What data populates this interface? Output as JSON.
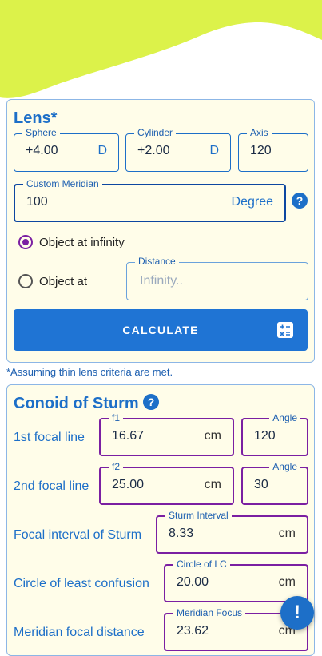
{
  "lens": {
    "title": "Lens*",
    "sphere": {
      "label": "Sphere",
      "value": "+4.00",
      "unit": "D"
    },
    "cylinder": {
      "label": "Cylinder",
      "value": "+2.00",
      "unit": "D"
    },
    "axis": {
      "label": "Axis",
      "value": "120"
    },
    "custom_meridian": {
      "label": "Custom Meridian",
      "value": "100",
      "unit": "Degree"
    },
    "help_glyph": "?",
    "option_infinity": "Object at infinity",
    "option_at": "Object at",
    "distance": {
      "label": "Distance",
      "placeholder": "Infinity.."
    },
    "calculate_label": "CALCULATE",
    "calc_icon": "calculator-icon"
  },
  "note": "*Assuming thin lens criteria are met.",
  "sturm": {
    "title": "Conoid of Sturm",
    "help_glyph": "?",
    "rows": [
      {
        "label": "1st focal line",
        "field_label": "f1",
        "value": "16.67",
        "unit": "cm",
        "angle_label": "Angle",
        "angle": "120"
      },
      {
        "label": "2nd focal line",
        "field_label": "f2",
        "value": "25.00",
        "unit": "cm",
        "angle_label": "Angle",
        "angle": "30"
      }
    ],
    "interval": {
      "label": "Focal interval of Sturm",
      "field_label": "Sturm Interval",
      "value": "8.33",
      "unit": "cm"
    },
    "circle": {
      "label": "Circle of least confusion",
      "field_label": "Circle of LC",
      "value": "20.00",
      "unit": "cm"
    },
    "meridian": {
      "label": "Meridian focal distance",
      "field_label": "Meridian Focus",
      "value": "23.62",
      "unit": "cm"
    }
  },
  "fab_glyph": "!",
  "colors": {
    "accent": "#1d6fc8",
    "wave": "#dcf24a",
    "card_bg": "#fffde9",
    "purple": "#7b1fa2"
  }
}
